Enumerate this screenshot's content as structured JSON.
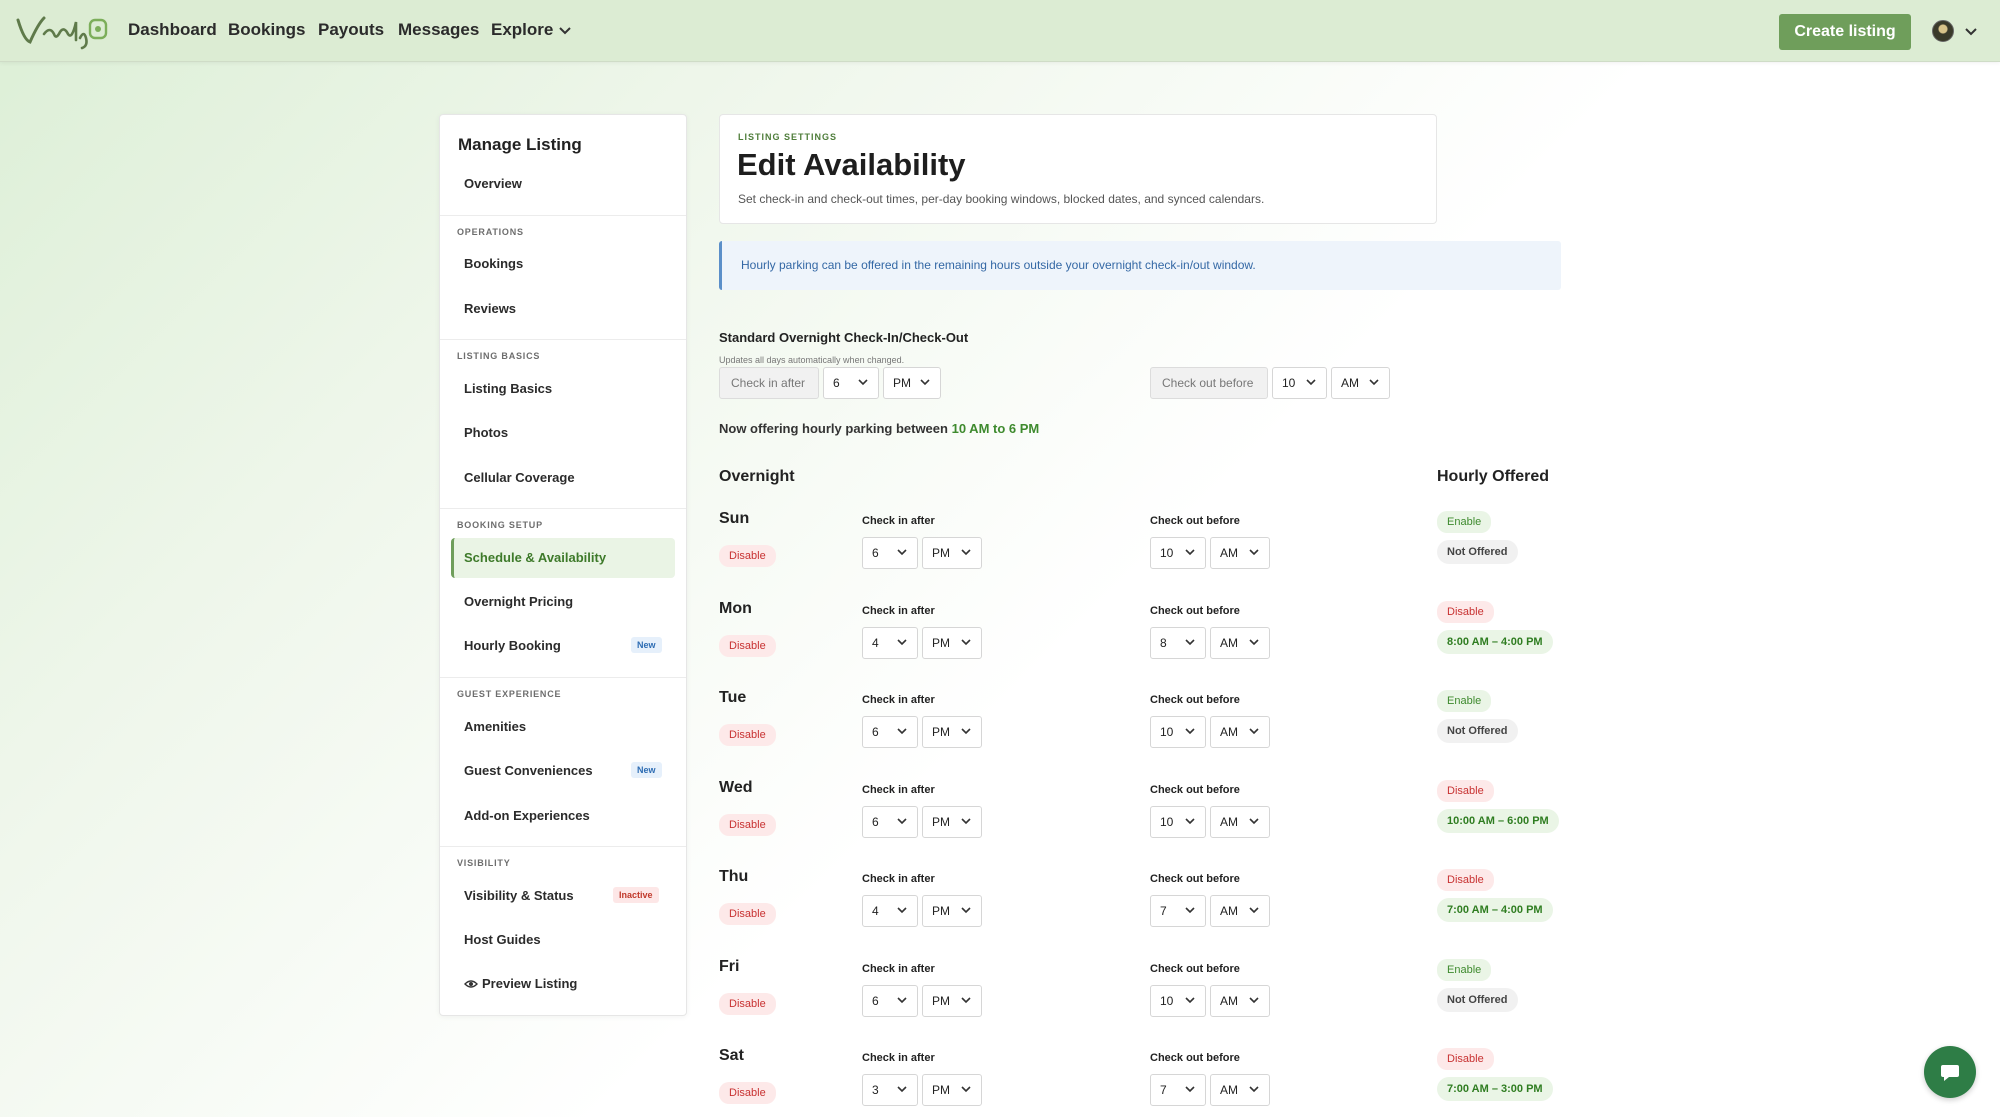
{
  "nav": {
    "links": [
      "Dashboard",
      "Bookings",
      "Payouts",
      "Messages",
      "Explore"
    ],
    "create_label": "Create listing",
    "accent": "#6f9e5b"
  },
  "sidebar": {
    "title": "Manage Listing",
    "overview": "Overview",
    "sections": {
      "operations": "OPERATIONS",
      "listing_basics": "LISTING BASICS",
      "booking_setup": "BOOKING SETUP",
      "guest_experience": "GUEST EXPERIENCE",
      "visibility": "VISIBILITY"
    },
    "items": {
      "bookings": "Bookings",
      "reviews": "Reviews",
      "listing_basics": "Listing Basics",
      "photos": "Photos",
      "cellular": "Cellular Coverage",
      "schedule": "Schedule & Availability",
      "overnight_pricing": "Overnight Pricing",
      "hourly_booking": "Hourly Booking",
      "amenities": "Amenities",
      "guest_conveniences": "Guest Conveniences",
      "addon": "Add-on Experiences",
      "visibility_status": "Visibility & Status",
      "host_guides": "Host Guides",
      "preview": "Preview Listing"
    },
    "badges": {
      "new": "New",
      "inactive": "Inactive"
    }
  },
  "header": {
    "eyebrow": "LISTING SETTINGS",
    "title": "Edit Availability",
    "subtitle": "Set check-in and check-out times, per-day booking windows, blocked dates, and synced calendars."
  },
  "banner": {
    "text": "Hourly parking can be offered in the remaining hours outside your overnight check-in/out window."
  },
  "standard": {
    "title": "Standard Overnight Check-In/Check-Out",
    "subtitle": "Updates all days automatically when changed.",
    "checkin_label": "Check in after",
    "checkin_hour": "6",
    "checkin_ampm": "PM",
    "checkout_label": "Check out before",
    "checkout_hour": "10",
    "checkout_ampm": "AM",
    "hourly_prefix": "Now offering hourly parking between",
    "hourly_range": "10 AM to 6 PM"
  },
  "columns": {
    "overnight": "Overnight",
    "hourly": "Hourly Offered",
    "checkin": "Check in after",
    "checkout": "Check out before",
    "disable": "Disable"
  },
  "days": [
    {
      "name": "Sun",
      "in_h": "6",
      "in_ap": "PM",
      "out_h": "10",
      "out_ap": "AM",
      "toggle": "Enable",
      "hourly": "Not Offered",
      "offered": false
    },
    {
      "name": "Mon",
      "in_h": "4",
      "in_ap": "PM",
      "out_h": "8",
      "out_ap": "AM",
      "toggle": "Disable",
      "hourly": "8:00 AM – 4:00 PM",
      "offered": true
    },
    {
      "name": "Tue",
      "in_h": "6",
      "in_ap": "PM",
      "out_h": "10",
      "out_ap": "AM",
      "toggle": "Enable",
      "hourly": "Not Offered",
      "offered": false
    },
    {
      "name": "Wed",
      "in_h": "6",
      "in_ap": "PM",
      "out_h": "10",
      "out_ap": "AM",
      "toggle": "Disable",
      "hourly": "10:00 AM – 6:00 PM",
      "offered": true
    },
    {
      "name": "Thu",
      "in_h": "4",
      "in_ap": "PM",
      "out_h": "7",
      "out_ap": "AM",
      "toggle": "Disable",
      "hourly": "7:00 AM – 4:00 PM",
      "offered": true
    },
    {
      "name": "Fri",
      "in_h": "6",
      "in_ap": "PM",
      "out_h": "10",
      "out_ap": "AM",
      "toggle": "Enable",
      "hourly": "Not Offered",
      "offered": false
    },
    {
      "name": "Sat",
      "in_h": "3",
      "in_ap": "PM",
      "out_h": "7",
      "out_ap": "AM",
      "toggle": "Disable",
      "hourly": "7:00 AM – 3:00 PM",
      "offered": true
    }
  ]
}
